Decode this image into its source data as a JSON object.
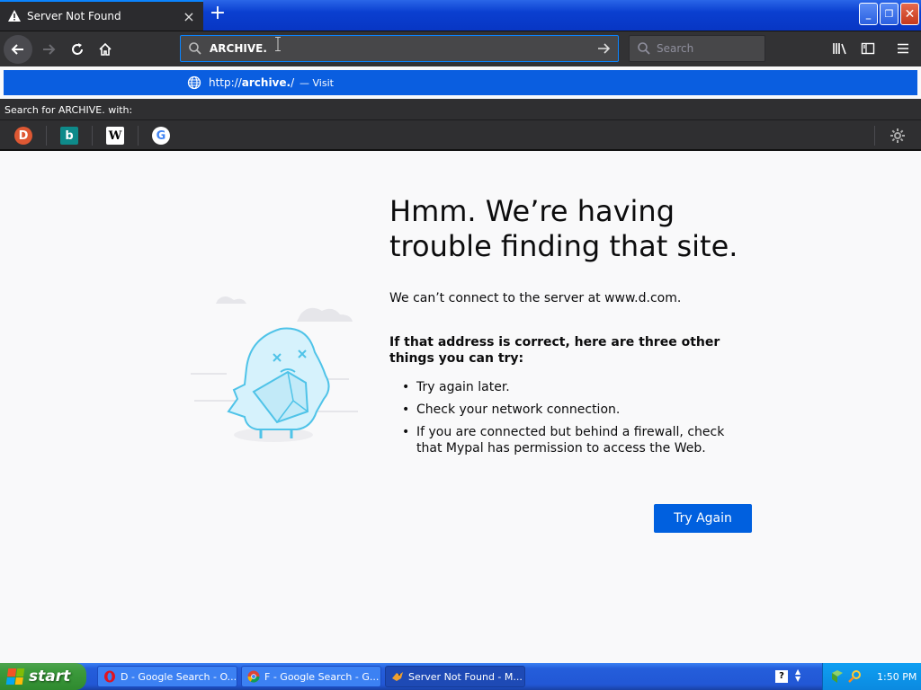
{
  "tab": {
    "title": "Server Not Found",
    "close": "×",
    "new": "+"
  },
  "window": {
    "minimize": "_",
    "restore": "❐",
    "close": "✕"
  },
  "urlbar": {
    "value": "ARCHIVE."
  },
  "searchbar": {
    "placeholder": "Search"
  },
  "autocomplete": {
    "url_prefix": "http://",
    "url_bold": "archive.",
    "url_suffix": "/",
    "action": "— Visit"
  },
  "search_for": "Search for ARCHIVE. with:",
  "engines": [
    {
      "name": "DuckDuckGo",
      "glyph": "D"
    },
    {
      "name": "Bing",
      "glyph": "b"
    },
    {
      "name": "Wikipedia",
      "glyph": "W"
    },
    {
      "name": "Google",
      "glyph": "G"
    }
  ],
  "error": {
    "title": "Hmm. We’re having trouble finding that site.",
    "description": "We can’t connect to the server at www.d.com.",
    "subtitle": "If that address is correct, here are three other things you can try:",
    "items": [
      "Try again later.",
      "Check your network connection.",
      "If you are connected but behind a firewall, check that Mypal has permission to access the Web."
    ],
    "button": "Try Again"
  },
  "taskbar": {
    "start": "start",
    "tasks": [
      {
        "label": "D - Google Search - O..."
      },
      {
        "label": "F - Google Search - G..."
      },
      {
        "label": "Server Not Found - M..."
      }
    ],
    "help": "?",
    "clock": "1:50 PM"
  },
  "colors": {
    "accent": "#0a84ff",
    "button": "#0060df",
    "taskbar": "#245edb"
  }
}
